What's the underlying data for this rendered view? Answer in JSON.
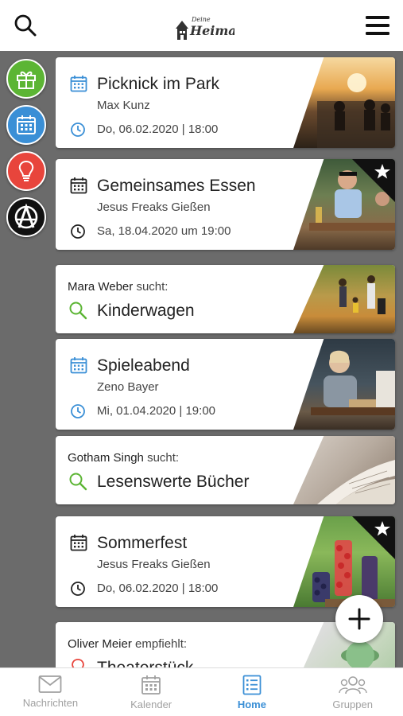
{
  "header": {
    "logo_text": "Heimat",
    "search_icon": "search-icon",
    "menu_icon": "hamburger-menu-icon"
  },
  "sidebar": {
    "buttons": [
      {
        "icon": "gift-icon",
        "color": "#5cb534"
      },
      {
        "icon": "calendar-icon",
        "color": "#3a8fd6"
      },
      {
        "icon": "lightbulb-icon",
        "color": "#e8453c"
      },
      {
        "icon": "anarchy-a-icon",
        "color": "#111111"
      }
    ]
  },
  "feed": {
    "cards": [
      {
        "type": "event",
        "title": "Picknick im Park",
        "organizer": "Max Kunz",
        "date": "Do, 06.02.2020 | 18:00",
        "icon_color": "#3a8fd6",
        "starred": false
      },
      {
        "type": "event",
        "title": "Gemeinsames Essen",
        "organizer": "Jesus Freaks Gießen",
        "date": "Sa, 18.04.2020 um 19:00",
        "icon_color": "#222222",
        "starred": true
      },
      {
        "type": "request",
        "person": "Mara Weber",
        "verb": "sucht:",
        "title": "Kinderwagen"
      },
      {
        "type": "event",
        "title": "Spieleabend",
        "organizer": "Zeno Bayer",
        "date": "Mi, 01.04.2020 | 19:00",
        "icon_color": "#3a8fd6",
        "starred": false
      },
      {
        "type": "request",
        "person": "Gotham Singh",
        "verb": "sucht:",
        "title": "Lesenswerte Bücher"
      },
      {
        "type": "event",
        "title": "Sommerfest",
        "organizer": "Jesus Freaks Gießen",
        "date": "Do, 06.02.2020 | 18:00",
        "icon_color": "#222222",
        "starred": true
      },
      {
        "type": "recommendation",
        "person": "Oliver Meier",
        "verb": "empfiehlt:",
        "title": "Theaterstück"
      }
    ]
  },
  "fab": {
    "icon": "plus-icon"
  },
  "bottom_nav": {
    "items": [
      {
        "label": "Nachrichten",
        "icon": "envelope-icon",
        "active": false
      },
      {
        "label": "Kalender",
        "icon": "calendar-icon",
        "active": false
      },
      {
        "label": "Home",
        "icon": "list-icon",
        "active": true
      },
      {
        "label": "Gruppen",
        "icon": "group-icon",
        "active": false
      }
    ]
  },
  "colors": {
    "accent_blue": "#3a8fd6",
    "accent_green": "#5cb534",
    "background": "#6b6b6b"
  }
}
